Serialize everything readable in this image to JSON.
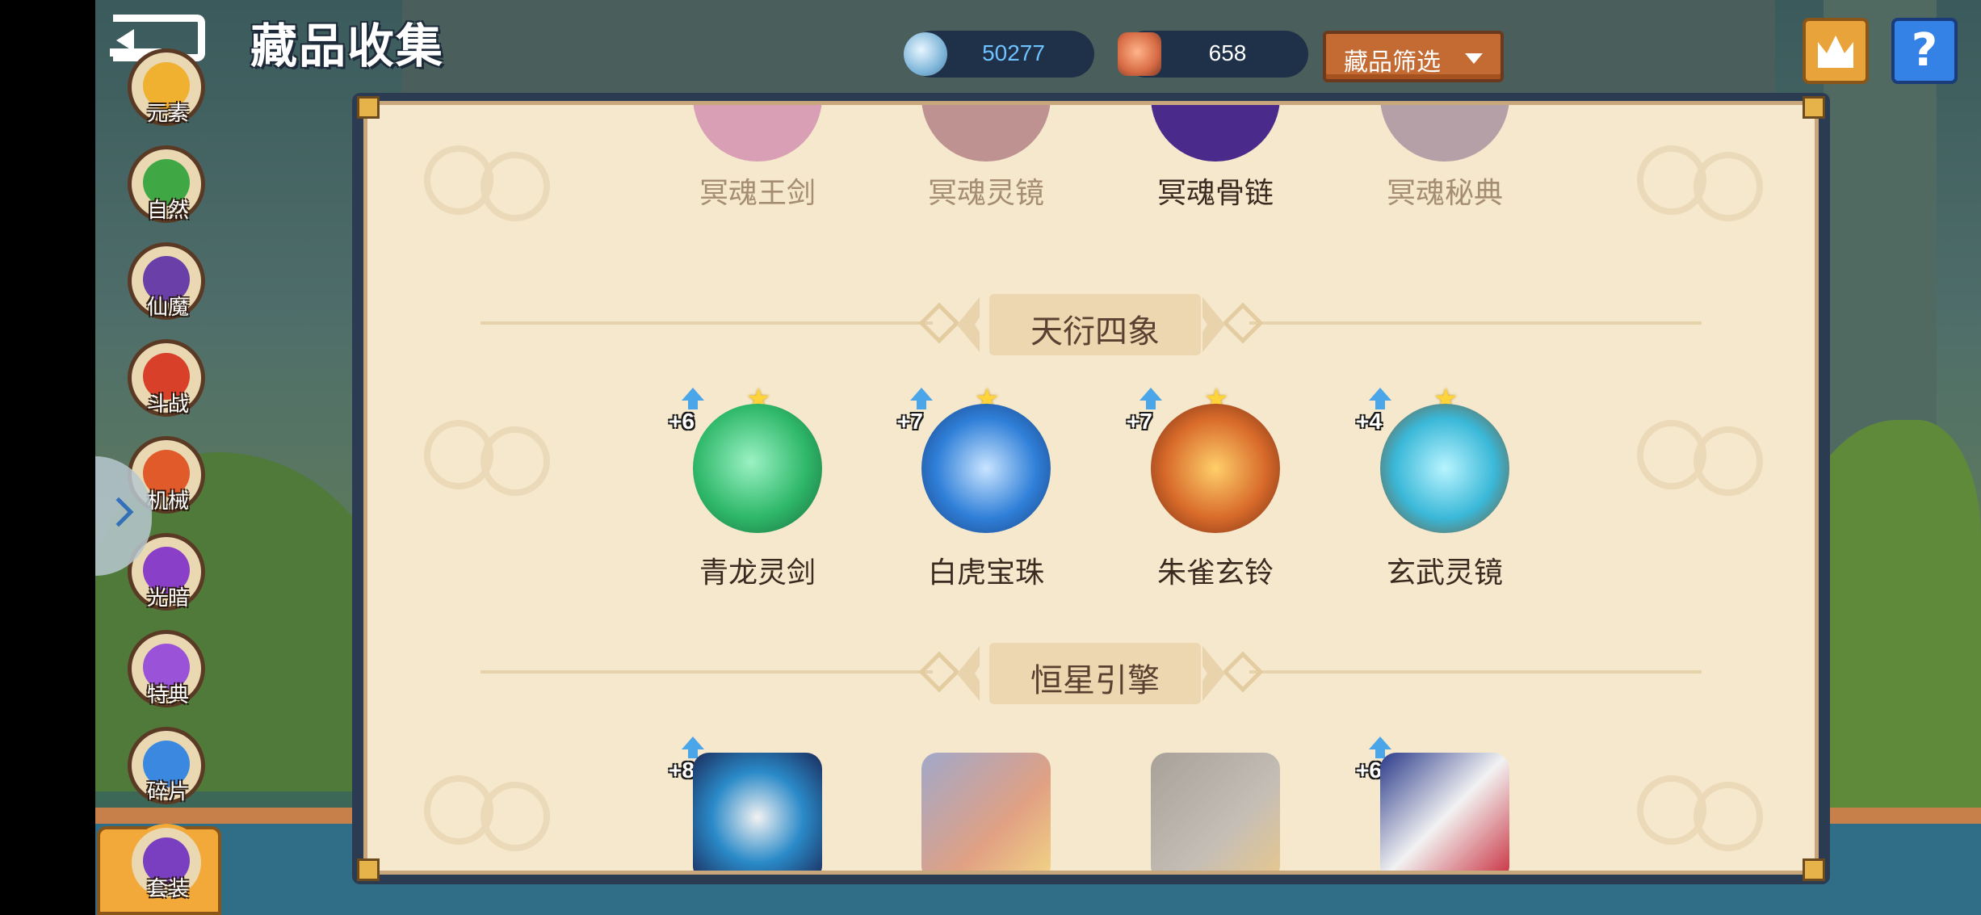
{
  "header": {
    "title": "藏品收集",
    "currency_silver": "50277",
    "currency_crystal": "658",
    "filter_label": "藏品筛选",
    "crown_icon": "crown-icon",
    "help_label": "?"
  },
  "sidebar": {
    "items": [
      {
        "label": "元素",
        "color": "#f0b030"
      },
      {
        "label": "自然",
        "color": "#3fa845"
      },
      {
        "label": "仙魔",
        "color": "#6b3fa8"
      },
      {
        "label": "斗战",
        "color": "#d8402a"
      },
      {
        "label": "机械",
        "color": "#e05a2a"
      },
      {
        "label": "光暗",
        "color": "#8a3fc8"
      },
      {
        "label": "特典",
        "color": "#9a52d8"
      },
      {
        "label": "碎片",
        "color": "#3a88e0"
      },
      {
        "label": "套装",
        "color": "#7a3fc0",
        "active": true
      }
    ]
  },
  "sections": [
    {
      "title": "",
      "items": [
        {
          "name": "冥魂王剑",
          "faded": true
        },
        {
          "name": "冥魂灵镜",
          "faded": true
        },
        {
          "name": "冥魂骨链",
          "faded": false
        },
        {
          "name": "冥魂秘典",
          "faded": true
        }
      ]
    },
    {
      "title": "天衍四象",
      "items": [
        {
          "name": "青龙灵剑",
          "level": "+6",
          "color": "#2fb86a"
        },
        {
          "name": "白虎宝珠",
          "level": "+7",
          "color": "#2f7fd8"
        },
        {
          "name": "朱雀玄铃",
          "level": "+7",
          "color": "#d86a2a"
        },
        {
          "name": "玄武灵镜",
          "level": "+4",
          "color": "#3ab8d8"
        }
      ]
    },
    {
      "title": "恒星引擎",
      "items": [
        {
          "level": "+8",
          "color": "#2a8ac8"
        },
        {
          "color": "#c84a2a",
          "faded": true
        },
        {
          "color": "#5a5a6a",
          "faded": true
        },
        {
          "level": "+6",
          "color": "#2a3a8a"
        }
      ]
    }
  ]
}
